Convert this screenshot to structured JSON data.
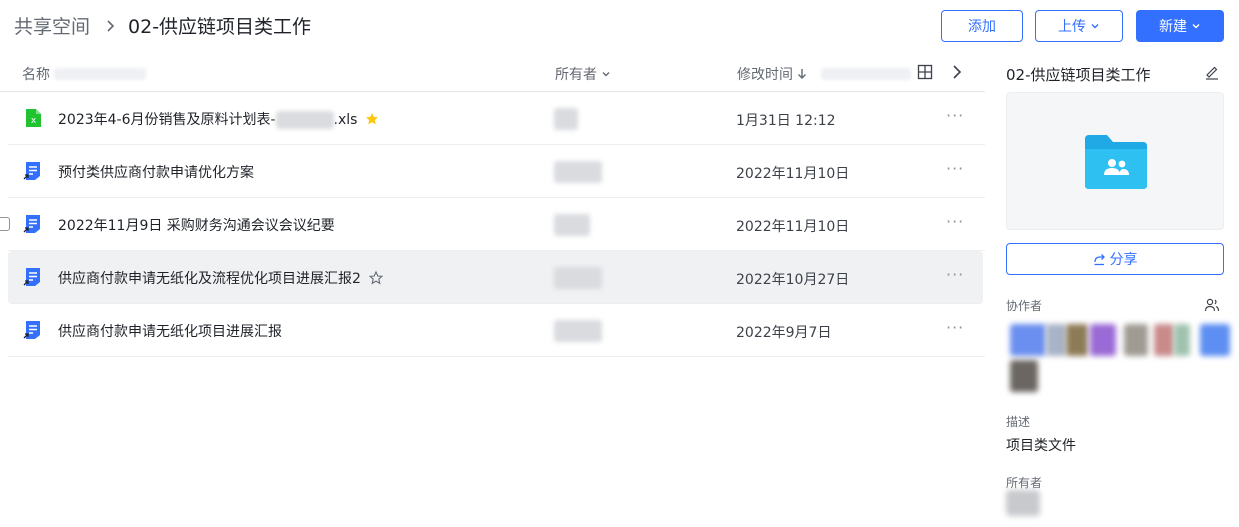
{
  "header": {
    "breadcrumb_root": "共享空间",
    "breadcrumb_current": "02-供应链项目类工作",
    "add_label": "添加",
    "upload_label": "上传",
    "new_label": "新建"
  },
  "list": {
    "columns": {
      "name": "名称",
      "owner": "所有者",
      "modified": "修改时间"
    },
    "rows": [
      {
        "type": "spreadsheet",
        "name_prefix": "2023年4-6月份销售及原料计划表-",
        "name_suffix": ".xls",
        "starred": true,
        "date": "1月31日 12:12"
      },
      {
        "type": "doc",
        "name": "预付类供应商付款申请优化方案",
        "date": "2022年11月10日"
      },
      {
        "type": "doc",
        "name": "2022年11月9日 采购财务沟通会议会议纪要",
        "date": "2022年11月10日"
      },
      {
        "type": "doc",
        "name": "供应商付款申请无纸化及流程优化项目进展汇报2",
        "star_outline": true,
        "date": "2022年10月27日"
      },
      {
        "type": "doc",
        "name": "供应商付款申请无纸化项目进展汇报",
        "date": "2022年9月7日"
      }
    ],
    "more_label": "···"
  },
  "panel": {
    "title": "02-供应链项目类工作",
    "share_label": "分享",
    "collaborators_label": "协作者",
    "description_label": "描述",
    "description_text": "项目类文件",
    "owner_label": "所有者"
  },
  "colors": {
    "accent": "#3370ff",
    "excel_green": "#21c330",
    "doc_blue": "#3370ff",
    "folder_cyan": "#21a9e6",
    "star_yellow": "#ffc60a"
  }
}
